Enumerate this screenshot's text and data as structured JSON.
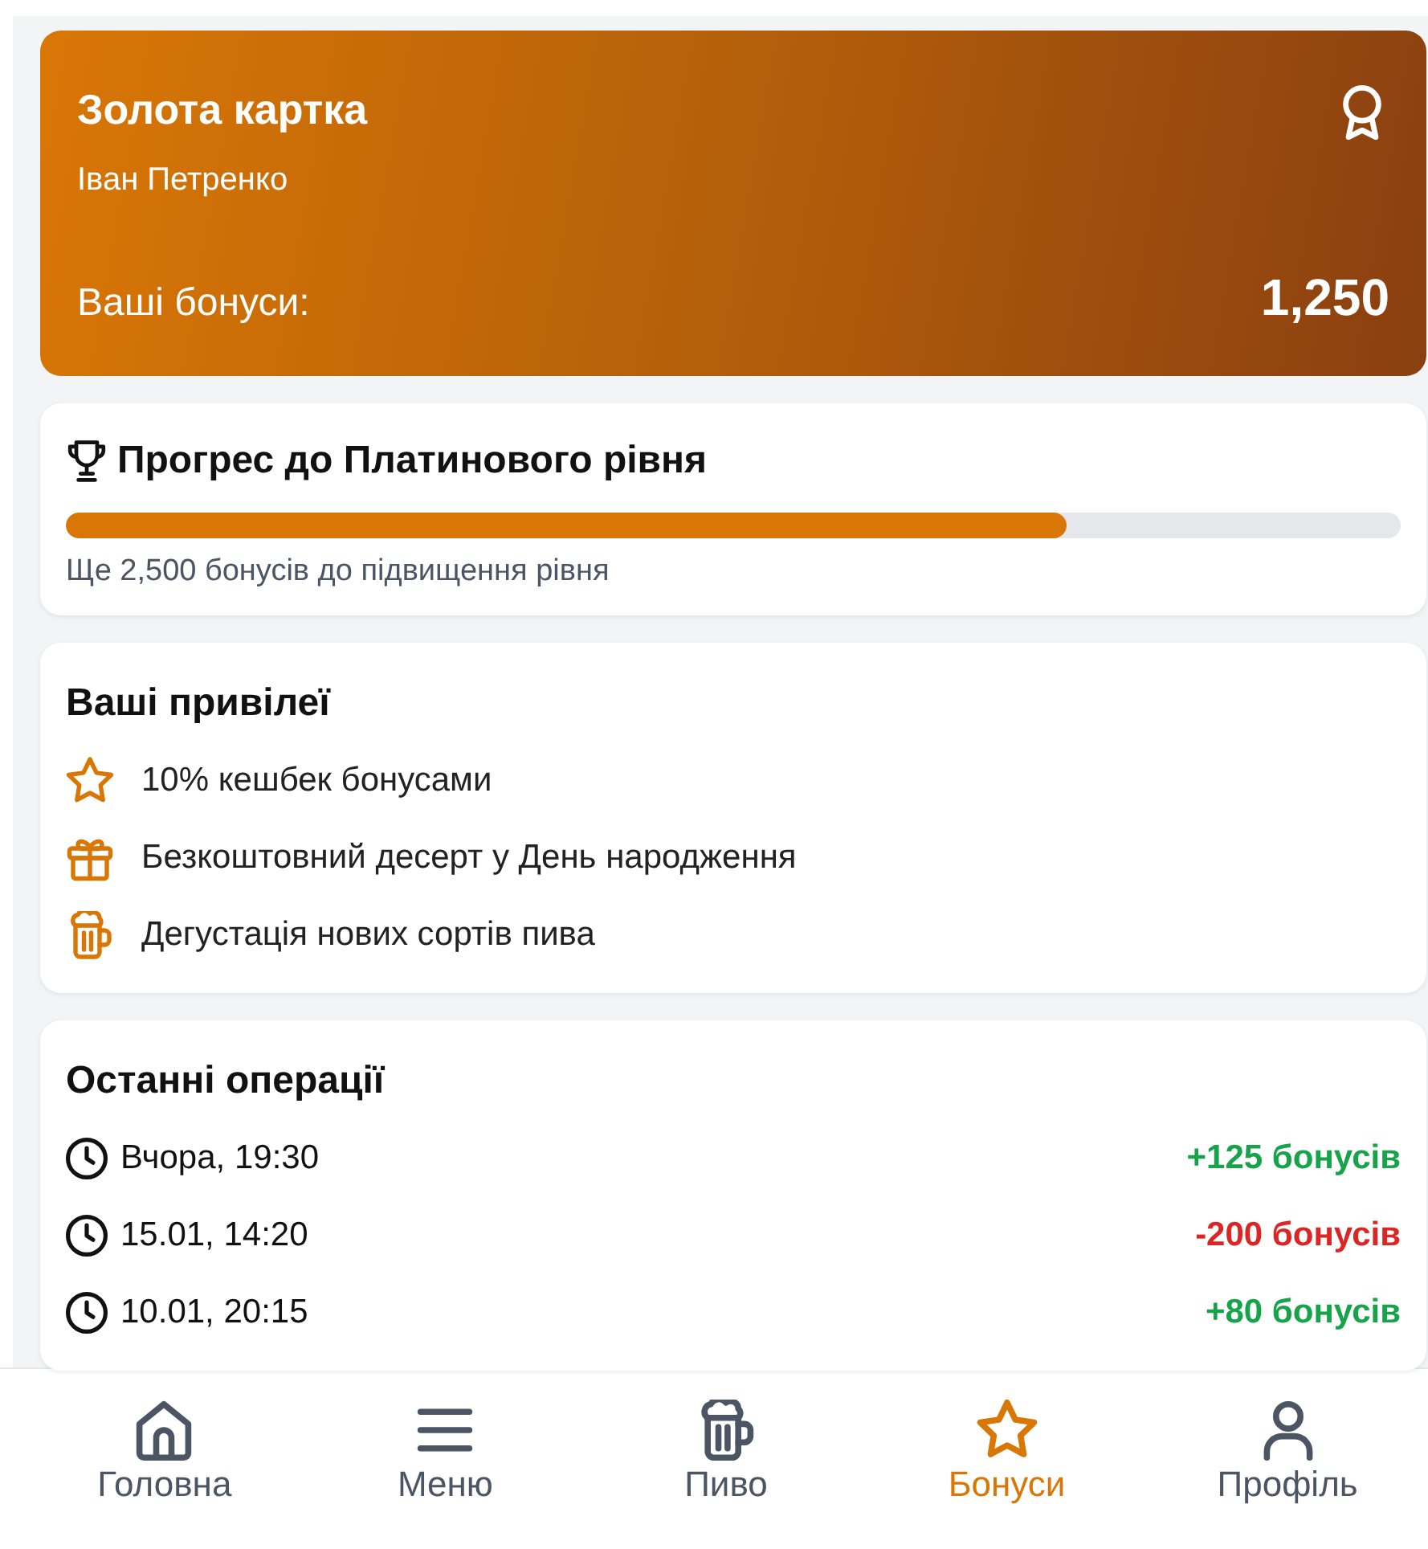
{
  "card": {
    "title": "Золота картка",
    "holder": "Іван Петренко",
    "bonus_label": "Ваші бонуси:",
    "bonus_value": "1,250"
  },
  "progress": {
    "title": "Прогрес до Платинового рівня",
    "level": 0.75,
    "note": "Ще 2,500 бонусів до підвищення рівня"
  },
  "privileges": {
    "title": "Ваші привілеї",
    "items": [
      {
        "kind": "star",
        "text": "10% кешбек бонусами"
      },
      {
        "kind": "gift",
        "text": "Безкоштовний десерт у День народження"
      },
      {
        "kind": "beer",
        "text": "Дегустація нових сортів пива"
      }
    ]
  },
  "operations": {
    "title": "Останні операції",
    "items": [
      {
        "time": "Вчора, 19:30",
        "amount": "+125 бонусів",
        "kind": "credit"
      },
      {
        "time": "15.01, 14:20",
        "amount": "-200 бонусів",
        "kind": "debit"
      },
      {
        "time": "10.01, 20:15",
        "amount": "+80 бонусів",
        "kind": "credit"
      }
    ]
  },
  "nav": [
    {
      "kind": "home",
      "label": "Головна",
      "selected": false
    },
    {
      "kind": "menu",
      "label": "Меню",
      "selected": false
    },
    {
      "kind": "beer",
      "label": "Пиво",
      "selected": false
    },
    {
      "kind": "star",
      "label": "Бонуси",
      "selected": true
    },
    {
      "kind": "user",
      "label": "Профіль",
      "selected": false
    }
  ]
}
